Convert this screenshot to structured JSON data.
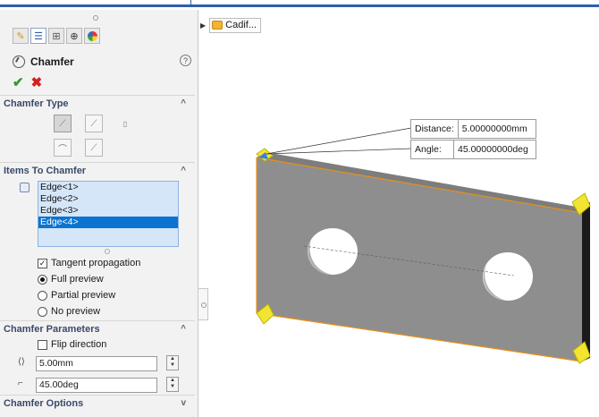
{
  "feature": {
    "title": "Chamfer",
    "help_symbol": "?",
    "ok_symbol": "✔",
    "cancel_symbol": "✖"
  },
  "tabs": [
    {
      "icon": "feature-manager-icon"
    },
    {
      "icon": "property-manager-icon"
    },
    {
      "icon": "configuration-manager-icon"
    },
    {
      "icon": "dimxpert-icon"
    },
    {
      "icon": "display-manager-icon"
    }
  ],
  "sections": {
    "chamfer_type": {
      "heading": "Chamfer Type"
    },
    "items": {
      "heading": "Items To Chamfer",
      "edges": [
        "Edge<1>",
        "Edge<2>",
        "Edge<3>",
        "Edge<4>"
      ],
      "selected_index": 3,
      "options": {
        "tangent_propagation": {
          "label": "Tangent propagation",
          "checked": true
        },
        "full_preview": {
          "label": "Full preview",
          "selected": true
        },
        "partial_preview": {
          "label": "Partial preview",
          "selected": false
        },
        "no_preview": {
          "label": "No preview",
          "selected": false
        }
      }
    },
    "parameters": {
      "heading": "Chamfer Parameters",
      "flip_direction": {
        "label": "Flip direction",
        "checked": false
      },
      "distance": "5.00mm",
      "angle": "45.00deg"
    },
    "options": {
      "heading": "Chamfer Options"
    }
  },
  "tree": {
    "label": "Cadif..."
  },
  "callout": {
    "distance_label": "Distance:",
    "distance_value": "5.00000000mm",
    "angle_label": "Angle:",
    "angle_value": "45.00000000deg"
  },
  "colors": {
    "accent_blue": "#2f5fa8",
    "edge_highlight": "#e8901a",
    "selection_blue": "#0a74d0",
    "part_gray": "#8c8c8c",
    "marker_yellow": "#f2e531"
  }
}
